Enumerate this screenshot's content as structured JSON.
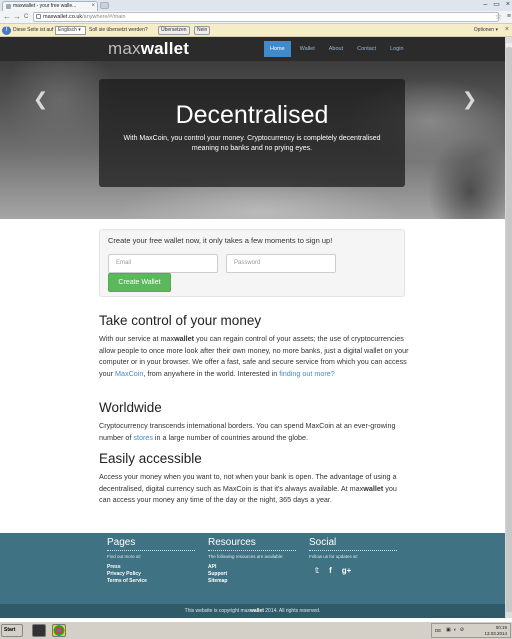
{
  "browser": {
    "tab_title": "maxwallet - your free walle...",
    "tab_close": "×",
    "window_controls": [
      "–",
      "▭",
      "×"
    ],
    "url_domain": "maxwallet.co.uk",
    "url_path": "/anywhere/#/main",
    "nav_back": "←",
    "nav_forward": "→",
    "nav_reload": "C",
    "star": "☆",
    "menu": "≡"
  },
  "translate_bar": {
    "icon": "T",
    "prefix": "Diese Seite ist auf",
    "language": "Englisch ▾",
    "question": "Soll sie übersetzt werden?",
    "translate_btn": "Übersetzen",
    "no_btn": "Nein",
    "options": "Optionen ▾",
    "close": "×"
  },
  "site": {
    "logo_max": "max",
    "logo_wallet": "wallet",
    "nav": [
      "Home",
      "Wallet",
      "About",
      "Contact",
      "Login"
    ]
  },
  "hero": {
    "prev": "❮",
    "next": "❯",
    "title": "Decentralised",
    "text": "With MaxCoin, you control your money. Cryptocurrency is completely decentralised meaning no banks and no prying eyes."
  },
  "signup": {
    "title": "Create your free wallet now, it only takes a few moments to sign up!",
    "email_placeholder": "Email",
    "password_placeholder": "Password",
    "button": "Create Wallet"
  },
  "sections": {
    "control": {
      "title": "Take control of your money",
      "p1": "With our service at max",
      "p1_bold": "wallet",
      "p2": " you can regain control of your assets; the use of cryptocurrencies allow people to once more look after their own money, no more banks, just a digital wallet on your computer or in your browser. We offer a fast, safe and secure service from which you can access your ",
      "p2_link": "MaxCoin",
      "p3": ", from anywhere in the world. Interested in ",
      "p3_link": "finding out more?"
    },
    "worldwide": {
      "title": "Worldwide",
      "p1": "Cryptocurrency transcends international borders. You can spend MaxCoin at an ever-growing number of ",
      "p1_link": "stores",
      "p2": " in a large number of countries around the globe."
    },
    "accessible": {
      "title": "Easily accessible",
      "p1": "Access your money when you want to, not when your bank is open. The advantage of using a decentralised, digital currency such as MaxCoin is that it's always available. At max",
      "p1_bold": "wallet",
      "p2": " you can access your money any time of the day or the night, 365 days a year."
    }
  },
  "footer": {
    "pages": {
      "title": "Pages",
      "sub": "Find out more at:",
      "links": [
        "Press",
        "Privacy Policy",
        "Terms of Service"
      ]
    },
    "resources": {
      "title": "Resources",
      "sub": "The following resources are available:",
      "links": [
        "API",
        "Support",
        "Sitemap"
      ]
    },
    "social": {
      "title": "Social",
      "sub": "Follow us for updates at:",
      "icons": [
        "twitter-icon",
        "facebook-icon",
        "googleplus-icon"
      ],
      "glyphs": [
        "𝕥",
        "f",
        "g+"
      ]
    },
    "copyright_pre": "This website is copyright max",
    "copyright_bold": "wallet",
    "copyright_post": " 2014. All rights reserved."
  },
  "taskbar": {
    "start": "Start",
    "lang": "DE",
    "time": "00:19",
    "date": "13.03.2014"
  },
  "colors": {
    "nav_bg": "#2b2b2b",
    "accent": "#428bca",
    "button_green": "#5cb85c",
    "footer_bg": "#3f7282"
  }
}
